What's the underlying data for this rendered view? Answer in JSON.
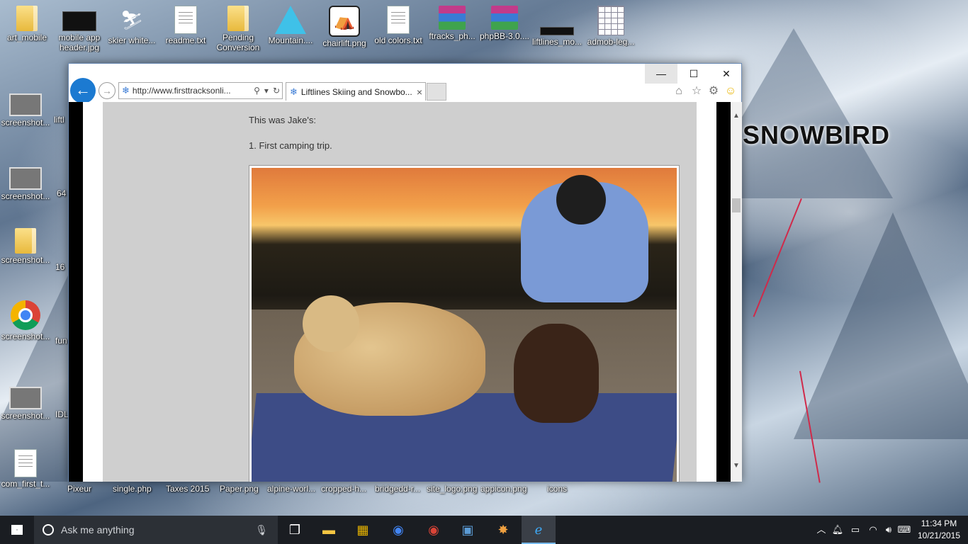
{
  "desktop": {
    "icons_top": [
      {
        "label": "art_mobile",
        "icon": "folder"
      },
      {
        "label": "mobile app header.jpg",
        "icon": "image-black"
      },
      {
        "label": "skier white...",
        "icon": "image-skier"
      },
      {
        "label": "readme.txt",
        "icon": "text-doc"
      },
      {
        "label": "Pending Conversion",
        "icon": "folder"
      },
      {
        "label": "Mountain....",
        "icon": "mountain"
      },
      {
        "label": "chairlift.png",
        "icon": "chairlift"
      },
      {
        "label": "old colors.txt",
        "icon": "text-doc"
      },
      {
        "label": "ftracks_ph...",
        "icon": "archive"
      },
      {
        "label": "phpBB-3.0....",
        "icon": "archive"
      },
      {
        "label": "liftlines_mo...",
        "icon": "image-black"
      },
      {
        "label": "admob-leg...",
        "icon": "spreadsheet"
      }
    ],
    "icons_left": [
      {
        "label": "screenshot...",
        "icon": "thumbnail"
      },
      {
        "label": "screenshot...",
        "icon": "thumbnail"
      },
      {
        "label": "screenshot...",
        "icon": "folder"
      },
      {
        "label": "screenshot...",
        "icon": "chrome"
      },
      {
        "label": "screenshot...",
        "icon": "thumbnail"
      },
      {
        "label": "com_first_t...",
        "icon": "blank-doc"
      }
    ],
    "left_partial_labels": [
      "liftl",
      "64",
      "16",
      "fun",
      "IDL"
    ],
    "bottom_row": [
      "Pixeur",
      "single.php",
      "Taxes 2015",
      "Paper.png",
      "alpine-worl...",
      "cropped-h...",
      "bridgedd-r...",
      "site_logo.png",
      "appicon.png",
      "icons"
    ],
    "wallpaper_text": "SNOWBIRD"
  },
  "browser": {
    "address": {
      "url": "http://www.firsttracksonli...",
      "search_icon": "search-icon",
      "refresh_icon": "refresh-icon"
    },
    "tab": {
      "title": "Liftlines Skiing and Snowbo...",
      "close": "×"
    },
    "window_controls": {
      "minimize": "—",
      "maximize": "☐",
      "close": "✕"
    },
    "content": {
      "line1": "This was Jake's:",
      "line2": "1. First camping trip."
    }
  },
  "taskbar": {
    "search_placeholder": "Ask me anything",
    "clock_time": "11:34 PM",
    "clock_date": "10/21/2015"
  },
  "colors": {
    "accent": "#1c7ad1",
    "taskbar": "#1a1d22",
    "content_bg": "#cfcfcf"
  }
}
